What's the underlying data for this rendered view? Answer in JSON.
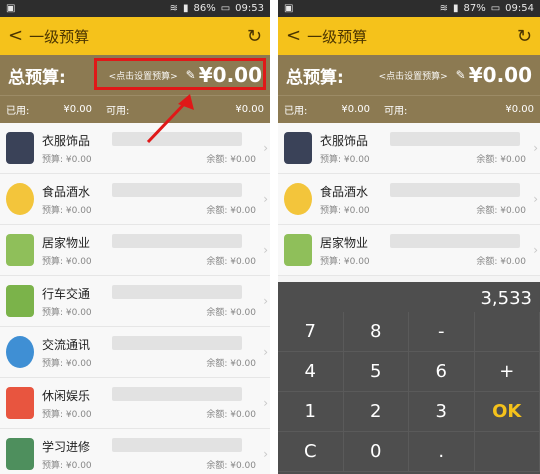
{
  "left": {
    "status": {
      "wifi": "wifi",
      "signal": "signal",
      "battery": "86%",
      "time": "09:53"
    },
    "header": {
      "back": "<",
      "title": "一级预算",
      "refresh": "↻"
    },
    "budget": {
      "label": "总预算:",
      "hint": "<点击设置预算>",
      "pencil": "✎",
      "amount": "¥0.00"
    },
    "summary": {
      "used_label": "已用:",
      "used_value": "¥0.00",
      "available_label": "可用:",
      "available_value": "¥0.00"
    },
    "items": [
      {
        "name": "衣服饰品",
        "pre": "预算: ¥0.00",
        "bal": "余额: ¥0.00",
        "icon": "clothing-icon"
      },
      {
        "name": "食品酒水",
        "pre": "预算: ¥0.00",
        "bal": "余额: ¥0.00",
        "icon": "food-icon"
      },
      {
        "name": "居家物业",
        "pre": "预算: ¥0.00",
        "bal": "余额: ¥0.00",
        "icon": "home-icon"
      },
      {
        "name": "行车交通",
        "pre": "预算: ¥0.00",
        "bal": "余额: ¥0.00",
        "icon": "transport-icon"
      },
      {
        "name": "交流通讯",
        "pre": "预算: ¥0.00",
        "bal": "余额: ¥0.00",
        "icon": "communication-icon"
      },
      {
        "name": "休闲娱乐",
        "pre": "预算: ¥0.00",
        "bal": "余额: ¥0.00",
        "icon": "entertainment-icon"
      },
      {
        "name": "学习进修",
        "pre": "预算: ¥0.00",
        "bal": "余额: ¥0.00",
        "icon": "study-icon"
      }
    ]
  },
  "right": {
    "status": {
      "battery": "87%",
      "time": "09:54"
    },
    "header": {
      "back": "<",
      "title": "一级预算",
      "refresh": "↻"
    },
    "budget": {
      "label": "总预算:",
      "hint": "<点击设置预算>",
      "pencil": "✎",
      "amount": "¥0.00"
    },
    "summary": {
      "used_label": "已用:",
      "used_value": "¥0.00",
      "available_label": "可用:",
      "available_value": "¥0.00"
    },
    "items": [
      {
        "name": "衣服饰品",
        "pre": "预算: ¥0.00",
        "bal": "余额: ¥0.00"
      },
      {
        "name": "食品酒水",
        "pre": "预算: ¥0.00",
        "bal": "余额: ¥0.00"
      },
      {
        "name": "居家物业",
        "pre": "预算: ¥0.00",
        "bal": "余额: ¥0.00"
      }
    ],
    "keypad": {
      "display": "3,533",
      "keys": [
        "7",
        "8",
        "-",
        "",
        "4",
        "5",
        "6",
        "+",
        "1",
        "2",
        "3",
        "OK",
        "C",
        "0",
        ".",
        ""
      ]
    }
  }
}
